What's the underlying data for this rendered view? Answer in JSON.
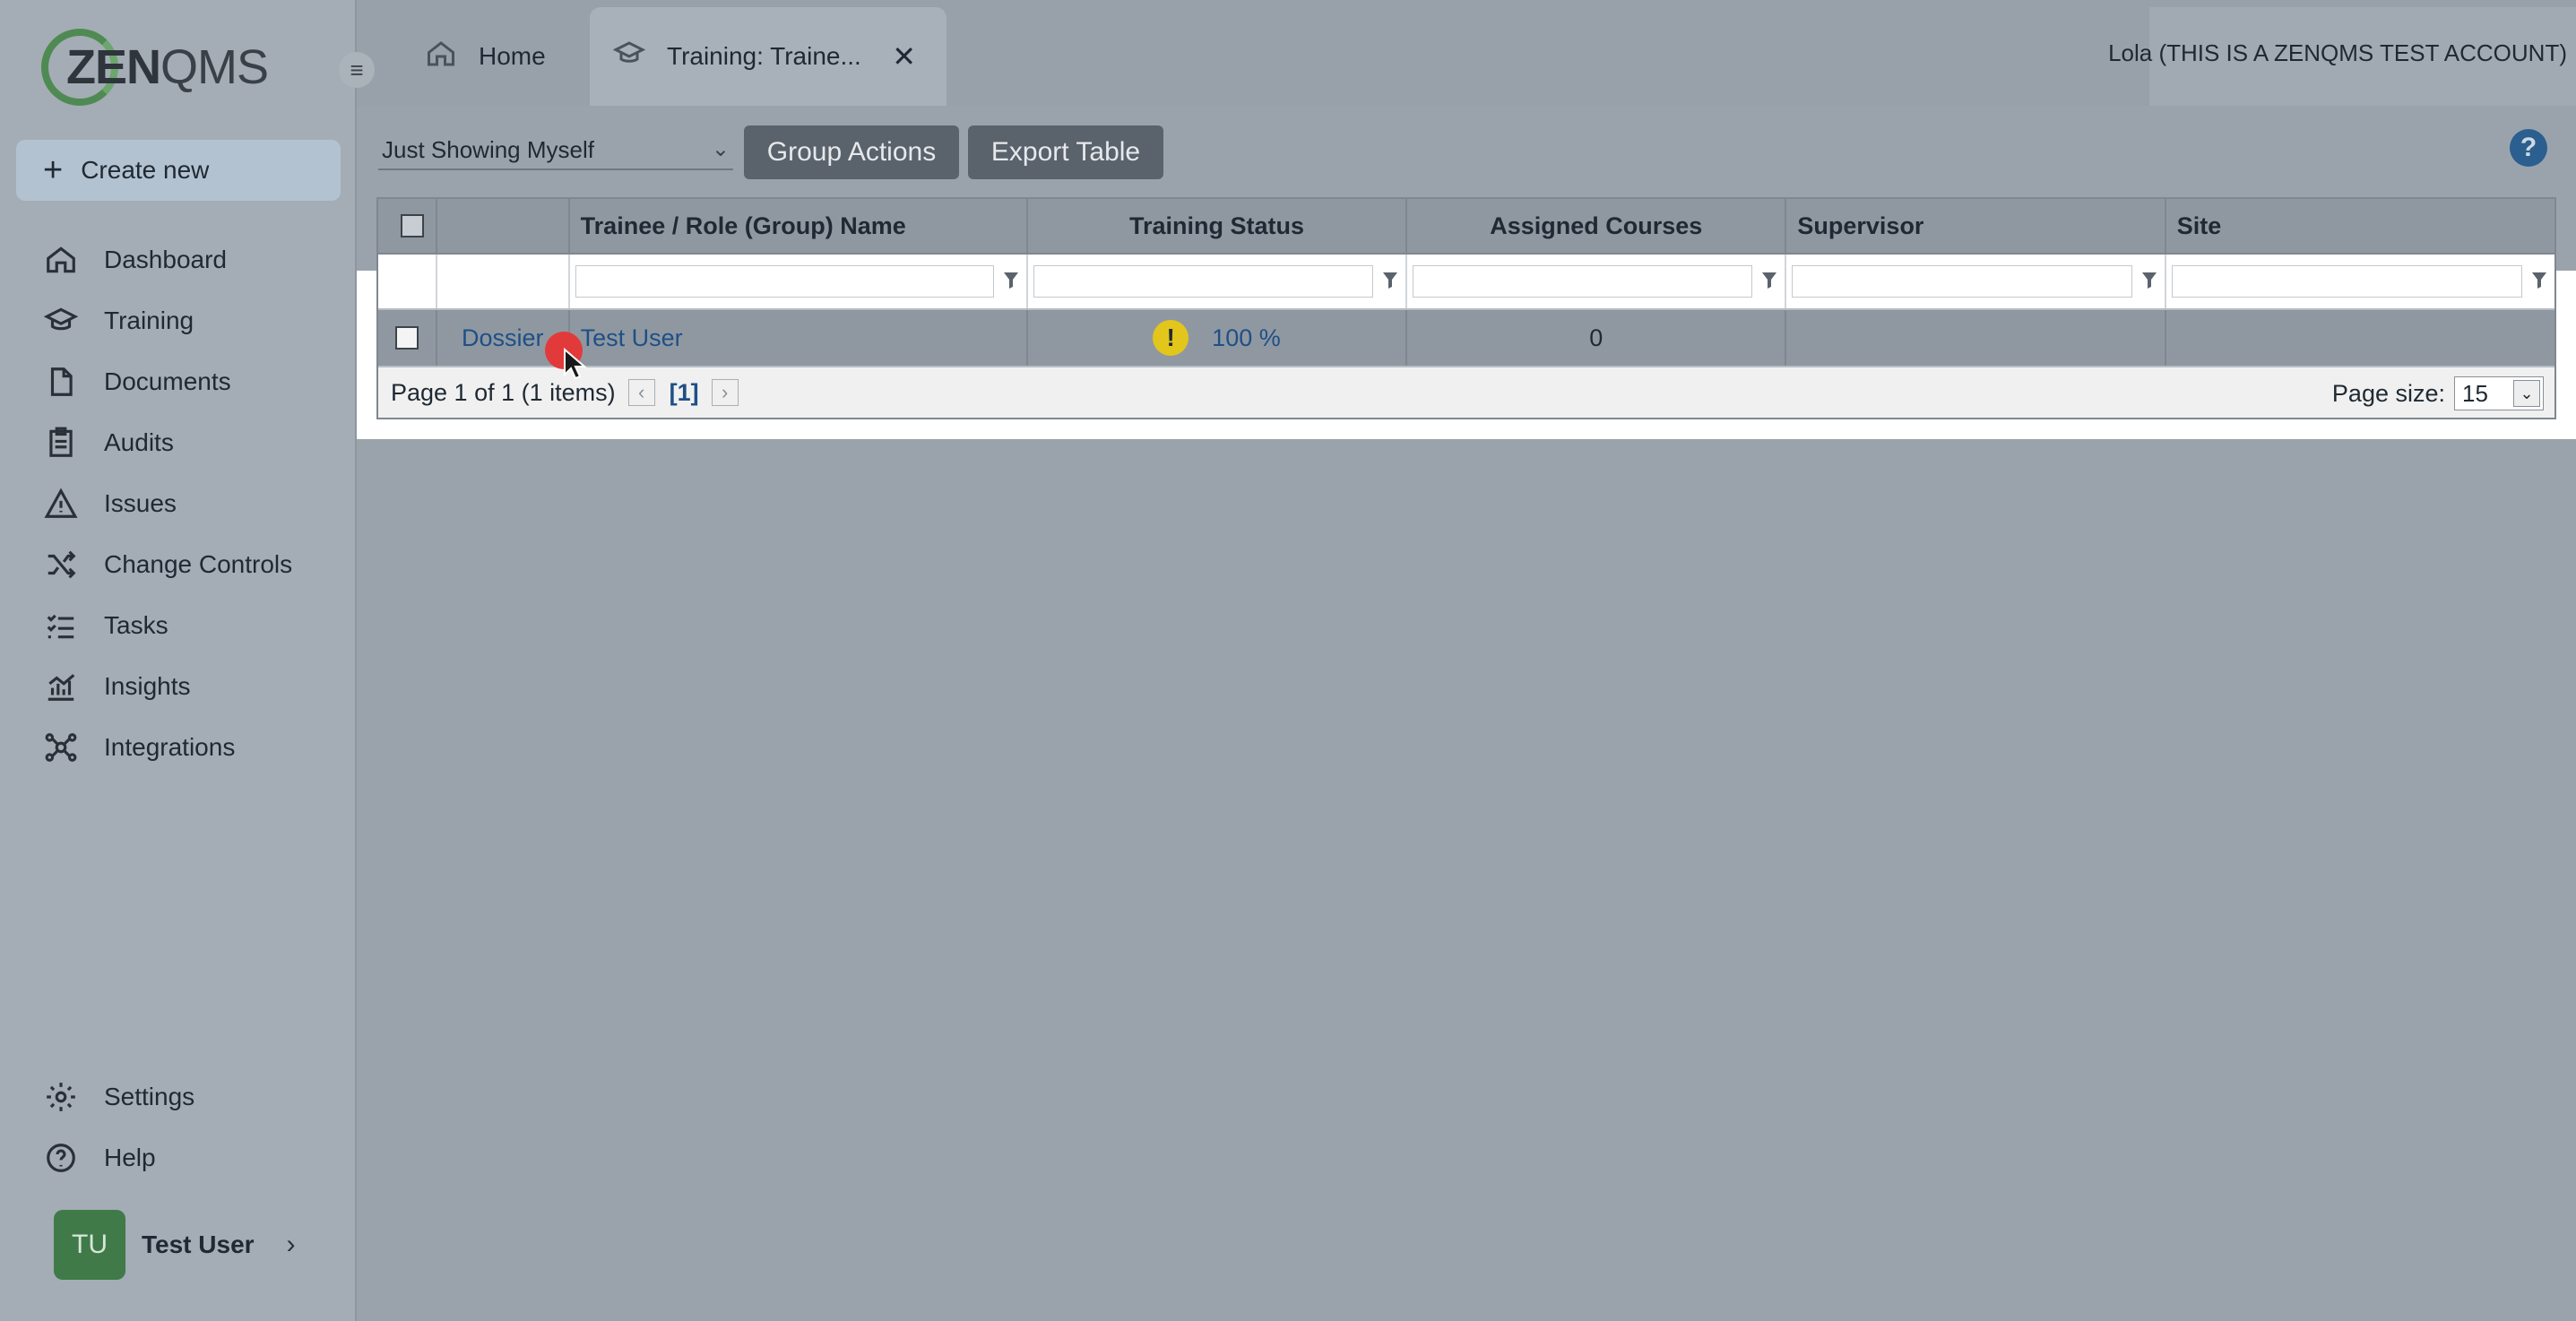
{
  "app": {
    "logo_text_bold": "ZEN",
    "logo_text_light": "QMS"
  },
  "sidebar": {
    "create_new": "Create new",
    "items": [
      {
        "label": "Dashboard",
        "icon": "home-icon"
      },
      {
        "label": "Training",
        "icon": "graduation-cap-icon"
      },
      {
        "label": "Documents",
        "icon": "document-icon"
      },
      {
        "label": "Audits",
        "icon": "clipboard-icon"
      },
      {
        "label": "Issues",
        "icon": "warning-triangle-icon"
      },
      {
        "label": "Change Controls",
        "icon": "shuffle-icon"
      },
      {
        "label": "Tasks",
        "icon": "checklist-icon"
      },
      {
        "label": "Insights",
        "icon": "chart-icon"
      },
      {
        "label": "Integrations",
        "icon": "hub-icon"
      }
    ],
    "bottom_items": [
      {
        "label": "Settings",
        "icon": "gear-icon"
      },
      {
        "label": "Help",
        "icon": "help-circle-icon"
      }
    ],
    "user": {
      "initials": "TU",
      "name": "Test User"
    }
  },
  "tabs": [
    {
      "label": "Home",
      "icon": "home-icon"
    },
    {
      "label": "Training: Traine...",
      "icon": "graduation-cap-icon",
      "active": true
    }
  ],
  "account": "Lola (THIS IS A ZENQMS TEST ACCOUNT)",
  "toolbar": {
    "scope": "Just Showing Myself",
    "group_actions": "Group Actions",
    "export_table": "Export Table"
  },
  "table": {
    "columns": [
      "",
      "",
      "Trainee / Role (Group) Name",
      "Training Status",
      "Assigned Courses",
      "Supervisor",
      "Site"
    ],
    "rows": [
      {
        "action": "Dossier",
        "name": "Test User",
        "status": "100 %",
        "assigned_courses": "0",
        "supervisor": "",
        "site": ""
      }
    ],
    "pager": {
      "summary": "Page 1 of 1 (1 items)",
      "current": "[1]",
      "page_size_label": "Page size:",
      "page_size": "15"
    }
  },
  "colors": {
    "accent": "#1f4f86",
    "warning": "#e2c61b",
    "brand_green": "#4f8a52"
  }
}
